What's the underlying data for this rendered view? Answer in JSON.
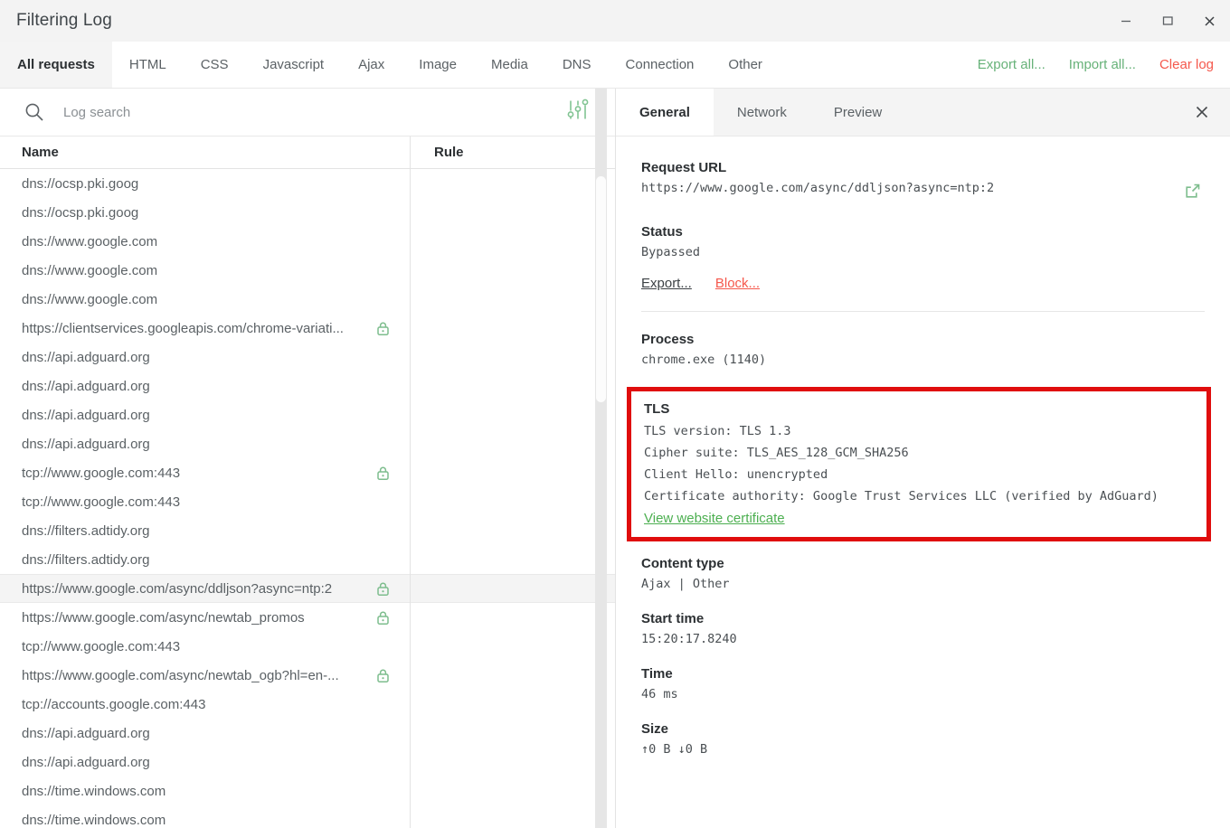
{
  "window": {
    "title": "Filtering Log",
    "controls": [
      {
        "name": "minimize",
        "glyph": "minimize-icon"
      },
      {
        "name": "maximize",
        "glyph": "maximize-icon"
      },
      {
        "name": "close",
        "glyph": "close-icon"
      }
    ]
  },
  "filter_tabs": [
    {
      "label": "All requests",
      "active": true
    },
    {
      "label": "HTML",
      "active": false
    },
    {
      "label": "CSS",
      "active": false
    },
    {
      "label": "Javascript",
      "active": false
    },
    {
      "label": "Ajax",
      "active": false
    },
    {
      "label": "Image",
      "active": false
    },
    {
      "label": "Media",
      "active": false
    },
    {
      "label": "DNS",
      "active": false
    },
    {
      "label": "Connection",
      "active": false
    },
    {
      "label": "Other",
      "active": false
    }
  ],
  "toolbar_actions": [
    {
      "label": "Export all...",
      "color": "#67b279"
    },
    {
      "label": "Import all...",
      "color": "#67b279"
    },
    {
      "label": "Clear log",
      "color": "#f5584c"
    }
  ],
  "search": {
    "placeholder": "Log search",
    "value": "",
    "icon": "search-icon",
    "filter_icon": "sliders-filter-icon"
  },
  "list": {
    "columns": [
      "Name",
      "Rule"
    ],
    "rows": [
      {
        "name": "dns://ocsp.pki.goog",
        "rule": "",
        "secure": false,
        "selected": false
      },
      {
        "name": "dns://ocsp.pki.goog",
        "rule": "",
        "secure": false,
        "selected": false
      },
      {
        "name": "dns://www.google.com",
        "rule": "",
        "secure": false,
        "selected": false
      },
      {
        "name": "dns://www.google.com",
        "rule": "",
        "secure": false,
        "selected": false
      },
      {
        "name": "dns://www.google.com",
        "rule": "",
        "secure": false,
        "selected": false
      },
      {
        "name": "https://clientservices.googleapis.com/chrome-variati...",
        "rule": "",
        "secure": true,
        "selected": false
      },
      {
        "name": "dns://api.adguard.org",
        "rule": "",
        "secure": false,
        "selected": false
      },
      {
        "name": "dns://api.adguard.org",
        "rule": "",
        "secure": false,
        "selected": false
      },
      {
        "name": "dns://api.adguard.org",
        "rule": "",
        "secure": false,
        "selected": false
      },
      {
        "name": "dns://api.adguard.org",
        "rule": "",
        "secure": false,
        "selected": false
      },
      {
        "name": "tcp://www.google.com:443",
        "rule": "",
        "secure": true,
        "selected": false
      },
      {
        "name": "tcp://www.google.com:443",
        "rule": "",
        "secure": false,
        "selected": false
      },
      {
        "name": "dns://filters.adtidy.org",
        "rule": "",
        "secure": false,
        "selected": false
      },
      {
        "name": "dns://filters.adtidy.org",
        "rule": "",
        "secure": false,
        "selected": false
      },
      {
        "name": "https://www.google.com/async/ddljson?async=ntp:2",
        "rule": "",
        "secure": true,
        "selected": true
      },
      {
        "name": "https://www.google.com/async/newtab_promos",
        "rule": "",
        "secure": true,
        "selected": false
      },
      {
        "name": "tcp://www.google.com:443",
        "rule": "",
        "secure": false,
        "selected": false
      },
      {
        "name": "https://www.google.com/async/newtab_ogb?hl=en-...",
        "rule": "",
        "secure": true,
        "selected": false
      },
      {
        "name": "tcp://accounts.google.com:443",
        "rule": "",
        "secure": false,
        "selected": false
      },
      {
        "name": "dns://api.adguard.org",
        "rule": "",
        "secure": false,
        "selected": false
      },
      {
        "name": "dns://api.adguard.org",
        "rule": "",
        "secure": false,
        "selected": false
      },
      {
        "name": "dns://time.windows.com",
        "rule": "",
        "secure": false,
        "selected": false
      },
      {
        "name": "dns://time.windows.com",
        "rule": "",
        "secure": false,
        "selected": false
      }
    ]
  },
  "detail": {
    "tabs": [
      {
        "label": "General",
        "active": true
      },
      {
        "label": "Network",
        "active": false
      },
      {
        "label": "Preview",
        "active": false
      }
    ],
    "close_icon": "close-icon",
    "request_url": {
      "label": "Request URL",
      "value": "https://www.google.com/async/ddljson?async=ntp:2",
      "open_icon": "external-link-icon"
    },
    "status": {
      "label": "Status",
      "value": "Bypassed"
    },
    "links": [
      {
        "label": "Export...",
        "style": "dark"
      },
      {
        "label": "Block...",
        "style": "red"
      }
    ],
    "process": {
      "label": "Process",
      "value": "chrome.exe (1140)"
    },
    "tls": {
      "label": "TLS",
      "lines": [
        "TLS version: TLS 1.3",
        "Cipher suite: TLS_AES_128_GCM_SHA256",
        "Client Hello: unencrypted",
        "Certificate authority: Google Trust Services LLC (verified by AdGuard)"
      ],
      "link": "View website certificate",
      "highlight_color": "#e00d0d"
    },
    "content_type": {
      "label": "Content type",
      "value": "Ajax | Other"
    },
    "start_time": {
      "label": "Start time",
      "value": "15:20:17.8240"
    },
    "time": {
      "label": "Time",
      "value": "46 ms"
    },
    "size": {
      "label": "Size",
      "value": "↑0 B ↓0 B"
    }
  },
  "colors": {
    "green": "#67b279",
    "red": "#f5584c",
    "highlight": "#e00d0d",
    "text": "#5b6165",
    "heading": "#2c3033"
  }
}
